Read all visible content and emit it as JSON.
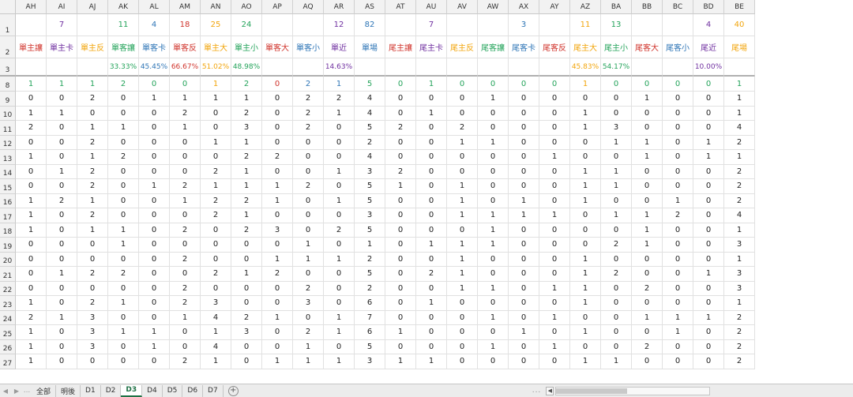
{
  "colors": {
    "red": "#d0342c",
    "purple": "#7030a0",
    "orange": "#f2a50c",
    "green": "#23a35a",
    "blue": "#2e75b6",
    "gray": "#222222"
  },
  "columns": [
    "AH",
    "AI",
    "AJ",
    "AK",
    "AL",
    "AM",
    "AN",
    "AO",
    "AP",
    "AQ",
    "AR",
    "AS",
    "AT",
    "AU",
    "AV",
    "AW",
    "AX",
    "AY",
    "AZ",
    "BA",
    "BB",
    "BC",
    "BD",
    "BE"
  ],
  "row1": {
    "number": "1",
    "values": [
      "",
      "7",
      "",
      "11",
      "4",
      "18",
      "25",
      "24",
      "",
      "",
      "12",
      "82",
      "",
      "7",
      "",
      "",
      "3",
      "",
      "11",
      "13",
      "",
      "",
      "4",
      "40"
    ],
    "colors": [
      "gray",
      "purple",
      "gray",
      "green",
      "blue",
      "red",
      "orange",
      "green",
      "gray",
      "gray",
      "purple",
      "blue",
      "gray",
      "purple",
      "gray",
      "gray",
      "blue",
      "gray",
      "orange",
      "green",
      "gray",
      "gray",
      "purple",
      "orange"
    ]
  },
  "row2": {
    "number": "2",
    "labels": [
      "單主讓",
      "單主卡",
      "單主反",
      "單客讓",
      "單客卡",
      "單客反",
      "單主大",
      "單主小",
      "單客大",
      "單客小",
      "單近",
      "單場",
      "尾主讓",
      "尾主卡",
      "尾主反",
      "尾客讓",
      "尾客卡",
      "尾客反",
      "尾主大",
      "尾主小",
      "尾客大",
      "尾客小",
      "尾近",
      "尾場"
    ],
    "colors": [
      "red",
      "purple",
      "orange",
      "green",
      "blue",
      "red",
      "orange",
      "green",
      "red",
      "blue",
      "purple",
      "blue",
      "red",
      "purple",
      "orange",
      "green",
      "blue",
      "red",
      "orange",
      "green",
      "red",
      "blue",
      "purple",
      "orange"
    ]
  },
  "row3": {
    "number": "3",
    "values": [
      "",
      "",
      "",
      "33.33%",
      "45.45%",
      "66.67%",
      "51.02%",
      "48.98%",
      "",
      "",
      "14.63%",
      "",
      "",
      "",
      "",
      "",
      "",
      "",
      "45.83%",
      "54.17%",
      "",
      "",
      "10.00%",
      ""
    ],
    "colors": [
      "gray",
      "gray",
      "gray",
      "green",
      "blue",
      "red",
      "orange",
      "green",
      "gray",
      "gray",
      "purple",
      "gray",
      "gray",
      "gray",
      "gray",
      "gray",
      "gray",
      "gray",
      "orange",
      "green",
      "gray",
      "gray",
      "purple",
      "gray"
    ]
  },
  "row8": {
    "number": "8",
    "values": [
      "1",
      "1",
      "1",
      "2",
      "0",
      "0",
      "1",
      "2",
      "0",
      "2",
      "1",
      "5",
      "0",
      "1",
      "0",
      "0",
      "0",
      "0",
      "1",
      "0",
      "0",
      "0",
      "0",
      "1"
    ],
    "colors": [
      "green",
      "green",
      "green",
      "green",
      "green",
      "green",
      "orange",
      "green",
      "red",
      "blue",
      "blue",
      "green",
      "green",
      "green",
      "green",
      "green",
      "green",
      "green",
      "orange",
      "green",
      "green",
      "green",
      "green",
      "green"
    ]
  },
  "data_rows": [
    {
      "n": "9",
      "v": [
        "0",
        "0",
        "2",
        "0",
        "1",
        "1",
        "1",
        "1",
        "0",
        "2",
        "2",
        "4",
        "0",
        "0",
        "0",
        "1",
        "0",
        "0",
        "0",
        "0",
        "1",
        "0",
        "0",
        "1"
      ]
    },
    {
      "n": "10",
      "v": [
        "1",
        "1",
        "0",
        "0",
        "0",
        "2",
        "0",
        "2",
        "0",
        "2",
        "1",
        "4",
        "0",
        "1",
        "0",
        "0",
        "0",
        "0",
        "1",
        "0",
        "0",
        "0",
        "0",
        "1"
      ]
    },
    {
      "n": "11",
      "v": [
        "2",
        "0",
        "1",
        "1",
        "0",
        "1",
        "0",
        "3",
        "0",
        "2",
        "0",
        "5",
        "2",
        "0",
        "2",
        "0",
        "0",
        "0",
        "1",
        "3",
        "0",
        "0",
        "0",
        "4"
      ]
    },
    {
      "n": "12",
      "v": [
        "0",
        "0",
        "2",
        "0",
        "0",
        "0",
        "1",
        "1",
        "0",
        "0",
        "0",
        "2",
        "0",
        "0",
        "1",
        "1",
        "0",
        "0",
        "0",
        "1",
        "1",
        "0",
        "1",
        "2"
      ]
    },
    {
      "n": "13",
      "v": [
        "1",
        "0",
        "1",
        "2",
        "0",
        "0",
        "0",
        "2",
        "2",
        "0",
        "0",
        "4",
        "0",
        "0",
        "0",
        "0",
        "0",
        "1",
        "0",
        "0",
        "1",
        "0",
        "1",
        "1"
      ]
    },
    {
      "n": "14",
      "v": [
        "0",
        "1",
        "2",
        "0",
        "0",
        "0",
        "2",
        "1",
        "0",
        "0",
        "1",
        "3",
        "2",
        "0",
        "0",
        "0",
        "0",
        "0",
        "1",
        "1",
        "0",
        "0",
        "0",
        "2"
      ]
    },
    {
      "n": "15",
      "v": [
        "0",
        "0",
        "2",
        "0",
        "1",
        "2",
        "1",
        "1",
        "1",
        "2",
        "0",
        "5",
        "1",
        "0",
        "1",
        "0",
        "0",
        "0",
        "1",
        "1",
        "0",
        "0",
        "0",
        "2"
      ]
    },
    {
      "n": "16",
      "v": [
        "1",
        "2",
        "1",
        "0",
        "0",
        "1",
        "2",
        "2",
        "1",
        "0",
        "1",
        "5",
        "0",
        "0",
        "1",
        "0",
        "1",
        "0",
        "1",
        "0",
        "0",
        "1",
        "0",
        "2"
      ]
    },
    {
      "n": "17",
      "v": [
        "1",
        "0",
        "2",
        "0",
        "0",
        "0",
        "2",
        "1",
        "0",
        "0",
        "0",
        "3",
        "0",
        "0",
        "1",
        "1",
        "1",
        "1",
        "0",
        "1",
        "1",
        "2",
        "0",
        "4"
      ]
    },
    {
      "n": "18",
      "v": [
        "1",
        "0",
        "1",
        "1",
        "0",
        "2",
        "0",
        "2",
        "3",
        "0",
        "2",
        "5",
        "0",
        "0",
        "0",
        "1",
        "0",
        "0",
        "0",
        "0",
        "1",
        "0",
        "0",
        "1"
      ]
    },
    {
      "n": "19",
      "v": [
        "0",
        "0",
        "0",
        "1",
        "0",
        "0",
        "0",
        "0",
        "0",
        "1",
        "0",
        "1",
        "0",
        "1",
        "1",
        "1",
        "0",
        "0",
        "0",
        "2",
        "1",
        "0",
        "0",
        "3"
      ]
    },
    {
      "n": "20",
      "v": [
        "0",
        "0",
        "0",
        "0",
        "0",
        "2",
        "0",
        "0",
        "1",
        "1",
        "1",
        "2",
        "0",
        "0",
        "1",
        "0",
        "0",
        "0",
        "1",
        "0",
        "0",
        "0",
        "0",
        "1"
      ]
    },
    {
      "n": "21",
      "v": [
        "0",
        "1",
        "2",
        "2",
        "0",
        "0",
        "2",
        "1",
        "2",
        "0",
        "0",
        "5",
        "0",
        "2",
        "1",
        "0",
        "0",
        "0",
        "1",
        "2",
        "0",
        "0",
        "1",
        "3"
      ]
    },
    {
      "n": "22",
      "v": [
        "0",
        "0",
        "0",
        "0",
        "0",
        "2",
        "0",
        "0",
        "0",
        "2",
        "0",
        "2",
        "0",
        "0",
        "1",
        "1",
        "0",
        "1",
        "1",
        "0",
        "2",
        "0",
        "0",
        "3"
      ]
    },
    {
      "n": "23",
      "v": [
        "1",
        "0",
        "2",
        "1",
        "0",
        "2",
        "3",
        "0",
        "0",
        "3",
        "0",
        "6",
        "0",
        "1",
        "0",
        "0",
        "0",
        "0",
        "1",
        "0",
        "0",
        "0",
        "0",
        "1"
      ]
    },
    {
      "n": "24",
      "v": [
        "2",
        "1",
        "3",
        "0",
        "0",
        "1",
        "4",
        "2",
        "1",
        "0",
        "1",
        "7",
        "0",
        "0",
        "0",
        "1",
        "0",
        "1",
        "0",
        "0",
        "1",
        "1",
        "1",
        "2"
      ]
    },
    {
      "n": "25",
      "v": [
        "1",
        "0",
        "3",
        "1",
        "1",
        "0",
        "1",
        "3",
        "0",
        "2",
        "1",
        "6",
        "1",
        "0",
        "0",
        "0",
        "1",
        "0",
        "1",
        "0",
        "0",
        "1",
        "0",
        "2"
      ]
    },
    {
      "n": "26",
      "v": [
        "1",
        "0",
        "3",
        "0",
        "1",
        "0",
        "4",
        "0",
        "0",
        "1",
        "0",
        "5",
        "0",
        "0",
        "0",
        "1",
        "0",
        "1",
        "0",
        "0",
        "2",
        "0",
        "0",
        "2"
      ]
    },
    {
      "n": "27",
      "v": [
        "1",
        "0",
        "0",
        "0",
        "0",
        "2",
        "1",
        "0",
        "1",
        "1",
        "1",
        "3",
        "1",
        "1",
        "0",
        "0",
        "0",
        "0",
        "1",
        "1",
        "0",
        "0",
        "0",
        "2"
      ]
    }
  ],
  "sheet_tabs": [
    "全部",
    "明後",
    "D1",
    "D2",
    "D3",
    "D4",
    "D5",
    "D6",
    "D7"
  ],
  "active_tab": "D3",
  "tabbar": {
    "dots": "...",
    "add_symbol": "+",
    "left_arrow": "◀",
    "right_arrow": "▶"
  }
}
